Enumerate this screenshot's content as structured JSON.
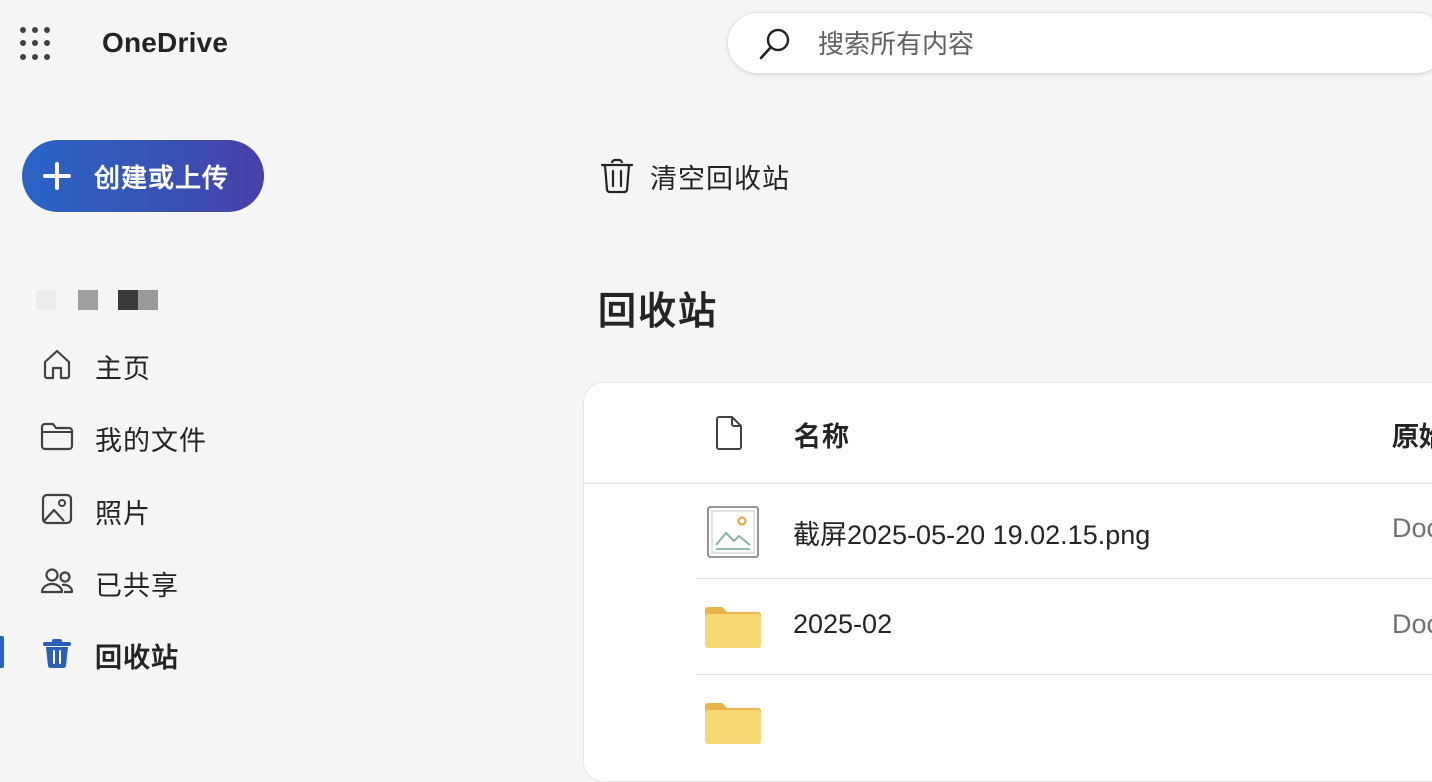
{
  "app": {
    "brand": "OneDrive"
  },
  "search": {
    "placeholder": "搜索所有内容"
  },
  "create_button": {
    "label": "创建或上传"
  },
  "nav": {
    "items": [
      {
        "label": "主页",
        "icon": "home-icon"
      },
      {
        "label": "我的文件",
        "icon": "folder-icon"
      },
      {
        "label": "照片",
        "icon": "photo-icon"
      },
      {
        "label": "已共享",
        "icon": "people-icon"
      },
      {
        "label": "回收站",
        "icon": "recycle-bin-icon",
        "active": true
      }
    ]
  },
  "command_bar": {
    "empty_bin_label": "清空回收站"
  },
  "page": {
    "title": "回收站"
  },
  "table": {
    "columns": {
      "name": "名称",
      "original_location": "原始"
    },
    "rows": [
      {
        "name": "截屏2025-05-20 19.02.15.png",
        "type": "image",
        "location": "Doc"
      },
      {
        "name": "2025-02",
        "type": "folder",
        "location": "Doc"
      },
      {
        "name": "",
        "type": "folder",
        "location": ""
      }
    ]
  },
  "colors": {
    "accent": "#2a63c6",
    "folder": "#f8d775",
    "background": "#f5f5f5"
  }
}
